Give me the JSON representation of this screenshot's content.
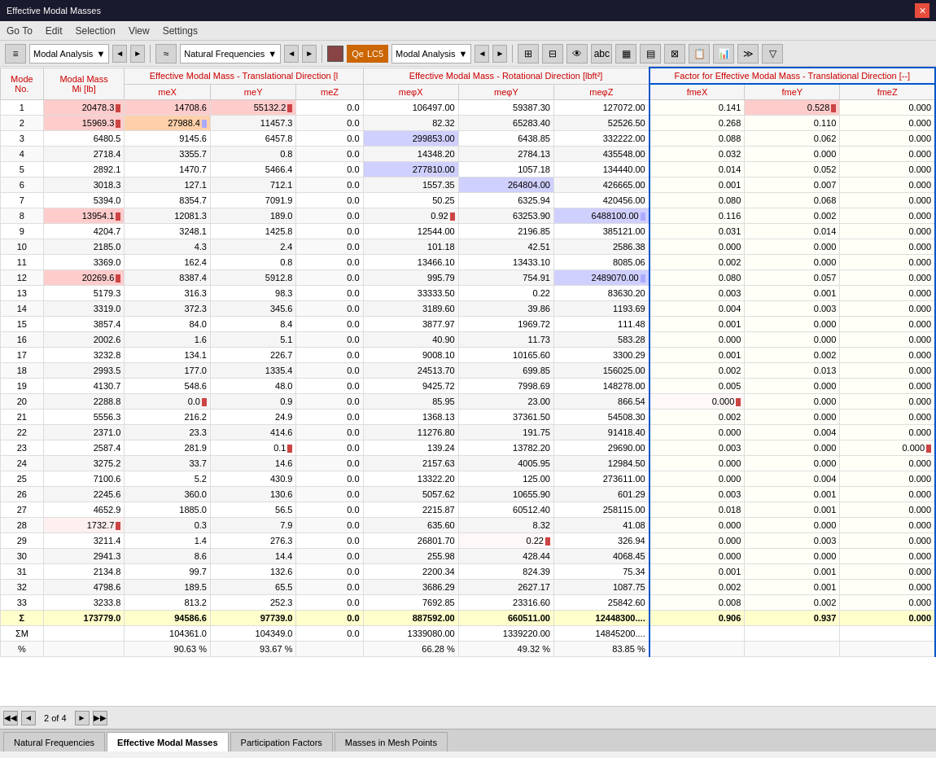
{
  "titleBar": {
    "title": "Effective Modal Masses",
    "closeLabel": "✕"
  },
  "menuBar": {
    "items": [
      "Go To",
      "Edit",
      "Selection",
      "View",
      "Settings"
    ]
  },
  "toolbar": {
    "analysisLabel": "Modal Analysis",
    "frequenciesLabel": "Natural Frequencies",
    "lcLabel": "LC5",
    "analysisLabel2": "Modal Analysis"
  },
  "table": {
    "headers": {
      "modeNo": "Mode\nNo.",
      "modalMass": "Modal Mass\nMi [lb]",
      "effModalTransLabel": "Effective Modal Mass - Translational Direction [l",
      "meX": "meX",
      "meY": "meY",
      "meZ": "meZ",
      "effModalRotLabel": "Effective Modal Mass - Rotational Direction [lbft²]",
      "meφX": "meφX",
      "meφY": "meφY",
      "meφZ": "meφZ",
      "factorLabel": "Factor for Effective Modal Mass - Translational Direction [--]",
      "fmeX": "fmeX",
      "fmeY": "fmeY",
      "fmeZ": "fmeZ"
    },
    "rows": [
      {
        "mode": 1,
        "mi": "20478.3",
        "meX": "14708.6",
        "meY": "55132.2",
        "meZ": "0.0",
        "meφX": "106497.00",
        "meφY": "59387.30",
        "meφZ": "127072.00",
        "fmeX": "0.141",
        "fmeY": "0.528",
        "fmeZ": "0.000",
        "miPink": true,
        "meXPink": true,
        "meYHighlight": true,
        "fmeYHighlight": true
      },
      {
        "mode": 2,
        "mi": "15969.3",
        "meX": "27988.4",
        "meY": "11457.3",
        "meZ": "0.0",
        "meφX": "82.32",
        "meφY": "65283.40",
        "meφZ": "52526.50",
        "fmeX": "0.268",
        "fmeY": "0.110",
        "fmeZ": "0.000",
        "miPink": true,
        "meXHighlight": true
      },
      {
        "mode": 3,
        "mi": "6480.5",
        "meX": "9145.6",
        "meY": "6457.8",
        "meZ": "0.0",
        "meφX": "299853.00",
        "meφY": "6438.85",
        "meφZ": "332222.00",
        "fmeX": "0.088",
        "fmeY": "0.062",
        "fmeZ": "0.000",
        "meφXHighlight": true
      },
      {
        "mode": 4,
        "mi": "2718.4",
        "meX": "3355.7",
        "meY": "0.8",
        "meZ": "0.0",
        "meφX": "14348.20",
        "meφY": "2784.13",
        "meφZ": "435548.00",
        "fmeX": "0.032",
        "fmeY": "0.000",
        "fmeZ": "0.000"
      },
      {
        "mode": 5,
        "mi": "2892.1",
        "meX": "1470.7",
        "meY": "5466.4",
        "meZ": "0.0",
        "meφX": "277810.00",
        "meφY": "1057.18",
        "meφZ": "134440.00",
        "fmeX": "0.014",
        "fmeY": "0.052",
        "fmeZ": "0.000",
        "meφXHighlight": true
      },
      {
        "mode": 6,
        "mi": "3018.3",
        "meX": "127.1",
        "meY": "712.1",
        "meZ": "0.0",
        "meφX": "1557.35",
        "meφY": "264804.00",
        "meφZ": "426665.00",
        "fmeX": "0.001",
        "fmeY": "0.007",
        "fmeZ": "0.000",
        "meφYHighlight": true
      },
      {
        "mode": 7,
        "mi": "5394.0",
        "meX": "8354.7",
        "meY": "7091.9",
        "meZ": "0.0",
        "meφX": "50.25",
        "meφY": "6325.94",
        "meφZ": "420456.00",
        "fmeX": "0.080",
        "fmeY": "0.068",
        "fmeZ": "0.000"
      },
      {
        "mode": 8,
        "mi": "13954.1",
        "meX": "12081.3",
        "meY": "189.0",
        "meZ": "0.0",
        "meφX": "0.92",
        "meφY": "63253.90",
        "meφZ": "6488100.00",
        "fmeX": "0.116",
        "fmeY": "0.002",
        "fmeZ": "0.000",
        "miPink": true,
        "meφXSmall": true,
        "meφZHighlight": true
      },
      {
        "mode": 9,
        "mi": "4204.7",
        "meX": "3248.1",
        "meY": "1425.8",
        "meZ": "0.0",
        "meφX": "12544.00",
        "meφY": "2196.85",
        "meφZ": "385121.00",
        "fmeX": "0.031",
        "fmeY": "0.014",
        "fmeZ": "0.000"
      },
      {
        "mode": 10,
        "mi": "2185.0",
        "meX": "4.3",
        "meY": "2.4",
        "meZ": "0.0",
        "meφX": "101.18",
        "meφY": "42.51",
        "meφZ": "2586.38",
        "fmeX": "0.000",
        "fmeY": "0.000",
        "fmeZ": "0.000"
      },
      {
        "mode": 11,
        "mi": "3369.0",
        "meX": "162.4",
        "meY": "0.8",
        "meZ": "0.0",
        "meφX": "13466.10",
        "meφY": "13433.10",
        "meφZ": "8085.06",
        "fmeX": "0.002",
        "fmeY": "0.000",
        "fmeZ": "0.000"
      },
      {
        "mode": 12,
        "mi": "20269.6",
        "meX": "8387.4",
        "meY": "5912.8",
        "meZ": "0.0",
        "meφX": "995.79",
        "meφY": "754.91",
        "meφZ": "2489070.00",
        "fmeX": "0.080",
        "fmeY": "0.057",
        "fmeZ": "0.000",
        "miPink": true,
        "meφZHighlight": true
      },
      {
        "mode": 13,
        "mi": "5179.3",
        "meX": "316.3",
        "meY": "98.3",
        "meZ": "0.0",
        "meφX": "33333.50",
        "meφY": "0.22",
        "meφZ": "83630.20",
        "fmeX": "0.003",
        "fmeY": "0.001",
        "fmeZ": "0.000"
      },
      {
        "mode": 14,
        "mi": "3319.0",
        "meX": "372.3",
        "meY": "345.6",
        "meZ": "0.0",
        "meφX": "3189.60",
        "meφY": "39.86",
        "meφZ": "1193.69",
        "fmeX": "0.004",
        "fmeY": "0.003",
        "fmeZ": "0.000"
      },
      {
        "mode": 15,
        "mi": "3857.4",
        "meX": "84.0",
        "meY": "8.4",
        "meZ": "0.0",
        "meφX": "3877.97",
        "meφY": "1969.72",
        "meφZ": "111.48",
        "fmeX": "0.001",
        "fmeY": "0.000",
        "fmeZ": "0.000"
      },
      {
        "mode": 16,
        "mi": "2002.6",
        "meX": "1.6",
        "meY": "5.1",
        "meZ": "0.0",
        "meφX": "40.90",
        "meφY": "11.73",
        "meφZ": "583.28",
        "fmeX": "0.000",
        "fmeY": "0.000",
        "fmeZ": "0.000"
      },
      {
        "mode": 17,
        "mi": "3232.8",
        "meX": "134.1",
        "meY": "226.7",
        "meZ": "0.0",
        "meφX": "9008.10",
        "meφY": "10165.60",
        "meφZ": "3300.29",
        "fmeX": "0.001",
        "fmeY": "0.002",
        "fmeZ": "0.000"
      },
      {
        "mode": 18,
        "mi": "2993.5",
        "meX": "177.0",
        "meY": "1335.4",
        "meZ": "0.0",
        "meφX": "24513.70",
        "meφY": "699.85",
        "meφZ": "156025.00",
        "fmeX": "0.002",
        "fmeY": "0.013",
        "fmeZ": "0.000"
      },
      {
        "mode": 19,
        "mi": "4130.7",
        "meX": "548.6",
        "meY": "48.0",
        "meZ": "0.0",
        "meφX": "9425.72",
        "meφY": "7998.69",
        "meφZ": "148278.00",
        "fmeX": "0.005",
        "fmeY": "0.000",
        "fmeZ": "0.000"
      },
      {
        "mode": 20,
        "mi": "2288.8",
        "meX": "0.0",
        "meY": "0.9",
        "meZ": "0.0",
        "meφX": "85.95",
        "meφY": "23.00",
        "meφZ": "866.54",
        "fmeX": "0.000",
        "fmeY": "0.000",
        "fmeZ": "0.000",
        "meXSmall": true,
        "fmeXSmall": true
      },
      {
        "mode": 21,
        "mi": "5556.3",
        "meX": "216.2",
        "meY": "24.9",
        "meZ": "0.0",
        "meφX": "1368.13",
        "meφY": "37361.50",
        "meφZ": "54508.30",
        "fmeX": "0.002",
        "fmeY": "0.000",
        "fmeZ": "0.000"
      },
      {
        "mode": 22,
        "mi": "2371.0",
        "meX": "23.3",
        "meY": "414.6",
        "meZ": "0.0",
        "meφX": "11276.80",
        "meφY": "191.75",
        "meφZ": "91418.40",
        "fmeX": "0.000",
        "fmeY": "0.004",
        "fmeZ": "0.000"
      },
      {
        "mode": 23,
        "mi": "2587.4",
        "meX": "281.9",
        "meY": "0.1",
        "meZ": "0.0",
        "meφX": "139.24",
        "meφY": "13782.20",
        "meφZ": "29690.00",
        "fmeX": "0.003",
        "fmeY": "0.000",
        "fmeZ": "0.000",
        "meYSmall": true,
        "fmeZSmall": true
      },
      {
        "mode": 24,
        "mi": "3275.2",
        "meX": "33.7",
        "meY": "14.6",
        "meZ": "0.0",
        "meφX": "2157.63",
        "meφY": "4005.95",
        "meφZ": "12984.50",
        "fmeX": "0.000",
        "fmeY": "0.000",
        "fmeZ": "0.000"
      },
      {
        "mode": 25,
        "mi": "7100.6",
        "meX": "5.2",
        "meY": "430.9",
        "meZ": "0.0",
        "meφX": "13322.20",
        "meφY": "125.00",
        "meφZ": "273611.00",
        "fmeX": "0.000",
        "fmeY": "0.004",
        "fmeZ": "0.000"
      },
      {
        "mode": 26,
        "mi": "2245.6",
        "meX": "360.0",
        "meY": "130.6",
        "meZ": "0.0",
        "meφX": "5057.62",
        "meφY": "10655.90",
        "meφZ": "601.29",
        "fmeX": "0.003",
        "fmeY": "0.001",
        "fmeZ": "0.000"
      },
      {
        "mode": 27,
        "mi": "4652.9",
        "meX": "1885.0",
        "meY": "56.5",
        "meZ": "0.0",
        "meφX": "2215.87",
        "meφY": "60512.40",
        "meφZ": "258115.00",
        "fmeX": "0.018",
        "fmeY": "0.001",
        "fmeZ": "0.000"
      },
      {
        "mode": 28,
        "mi": "1732.7",
        "meX": "0.3",
        "meY": "7.9",
        "meZ": "0.0",
        "meφX": "635.60",
        "meφY": "8.32",
        "meφZ": "41.08",
        "fmeX": "0.000",
        "fmeY": "0.000",
        "fmeZ": "0.000",
        "miSmall": true
      },
      {
        "mode": 29,
        "mi": "3211.4",
        "meX": "1.4",
        "meY": "276.3",
        "meZ": "0.0",
        "meφX": "26801.70",
        "meφY": "0.22",
        "meφZ": "326.94",
        "fmeX": "0.000",
        "fmeY": "0.003",
        "fmeZ": "0.000",
        "meφYSmall": true
      },
      {
        "mode": 30,
        "mi": "2941.3",
        "meX": "8.6",
        "meY": "14.4",
        "meZ": "0.0",
        "meφX": "255.98",
        "meφY": "428.44",
        "meφZ": "4068.45",
        "fmeX": "0.000",
        "fmeY": "0.000",
        "fmeZ": "0.000"
      },
      {
        "mode": 31,
        "mi": "2134.8",
        "meX": "99.7",
        "meY": "132.6",
        "meZ": "0.0",
        "meφX": "2200.34",
        "meφY": "824.39",
        "meφZ": "75.34",
        "fmeX": "0.001",
        "fmeY": "0.001",
        "fmeZ": "0.000"
      },
      {
        "mode": 32,
        "mi": "4798.6",
        "meX": "189.5",
        "meY": "65.5",
        "meZ": "0.0",
        "meφX": "3686.29",
        "meφY": "2627.17",
        "meφZ": "1087.75",
        "fmeX": "0.002",
        "fmeY": "0.001",
        "fmeZ": "0.000"
      },
      {
        "mode": 33,
        "mi": "3233.8",
        "meX": "813.2",
        "meY": "252.3",
        "meZ": "0.0",
        "meφX": "7692.85",
        "meφY": "23316.60",
        "meφZ": "25842.60",
        "fmeX": "0.008",
        "fmeY": "0.002",
        "fmeZ": "0.000"
      }
    ],
    "sumRow": {
      "label": "Σ",
      "mi": "173779.0",
      "meX": "94586.6",
      "meY": "97739.0",
      "meZ": "0.0",
      "meφX": "887592.00",
      "meφY": "660511.00",
      "meφZ": "12448300....",
      "fmeX": "0.906",
      "fmeY": "0.937",
      "fmeZ": "0.000"
    },
    "sumMRow": {
      "label": "ΣM",
      "meX": "104361.0",
      "meY": "104349.0",
      "meZ": "0.0",
      "meφX": "1339080.00",
      "meφY": "1339220.00",
      "meφZ": "14845200...."
    },
    "percentRow": {
      "label": "%",
      "meX": "90.63 %",
      "meY": "93.67 %",
      "meφX": "66.28 %",
      "meφY": "49.32 %",
      "meφZ": "83.85 %"
    }
  },
  "pageNav": {
    "current": "2 of 4",
    "prevLabel": "◄",
    "nextLabel": "►",
    "firstLabel": "◀◀",
    "lastLabel": "▶▶"
  },
  "tabs": [
    {
      "label": "Natural Frequencies",
      "active": false
    },
    {
      "label": "Effective Modal Masses",
      "active": true
    },
    {
      "label": "Participation Factors",
      "active": false
    },
    {
      "label": "Masses in Mesh Points",
      "active": false
    }
  ]
}
